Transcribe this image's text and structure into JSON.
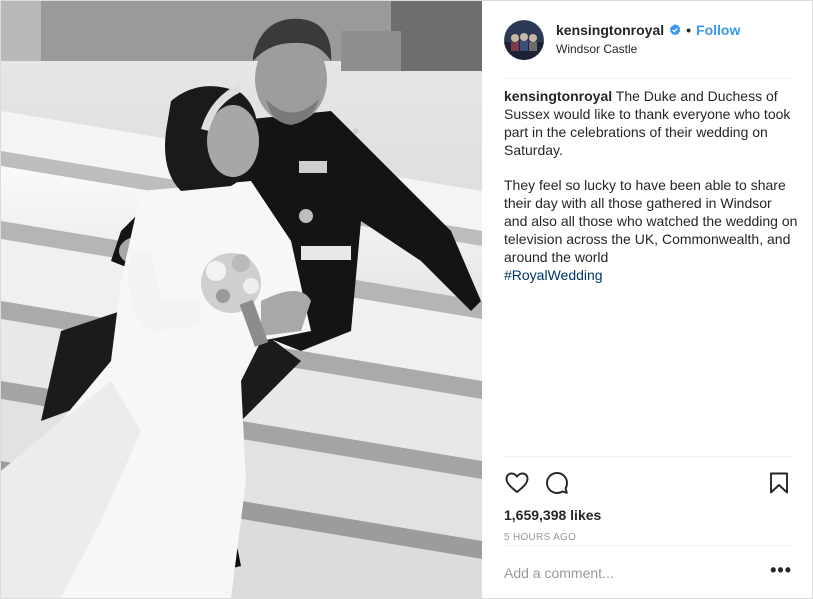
{
  "post": {
    "photo": {
      "subject": "black-and-white wedding photo of couple seated on stone steps"
    },
    "header": {
      "username": "kensingtonroyal",
      "verified_icon": "verified-badge-icon",
      "separator": "•",
      "follow_label": "Follow",
      "location": "Windsor Castle"
    },
    "caption": {
      "username": "kensingtonroyal",
      "paragraph1": "The Duke and Duchess of Sussex would like to thank everyone who took part in the celebrations of their wedding on Saturday.",
      "paragraph2": "They feel so lucky to have been able to share their day with all those gathered in Windsor and also all those who watched the wedding on television across the UK, Commonwealth, and around the world",
      "hashtag": "#RoyalWedding"
    },
    "actions": {
      "like_icon": "heart-icon",
      "comment_icon": "comment-bubble-icon",
      "save_icon": "bookmark-icon"
    },
    "likes": "1,659,398 likes",
    "timestamp": "5 HOURS AGO",
    "comment": {
      "placeholder": "Add a comment...",
      "more_label": "•••"
    },
    "colors": {
      "link_blue": "#3897f0",
      "hashtag_blue": "#003569",
      "text": "#262626",
      "muted": "#999999",
      "divider": "#efefef"
    }
  }
}
